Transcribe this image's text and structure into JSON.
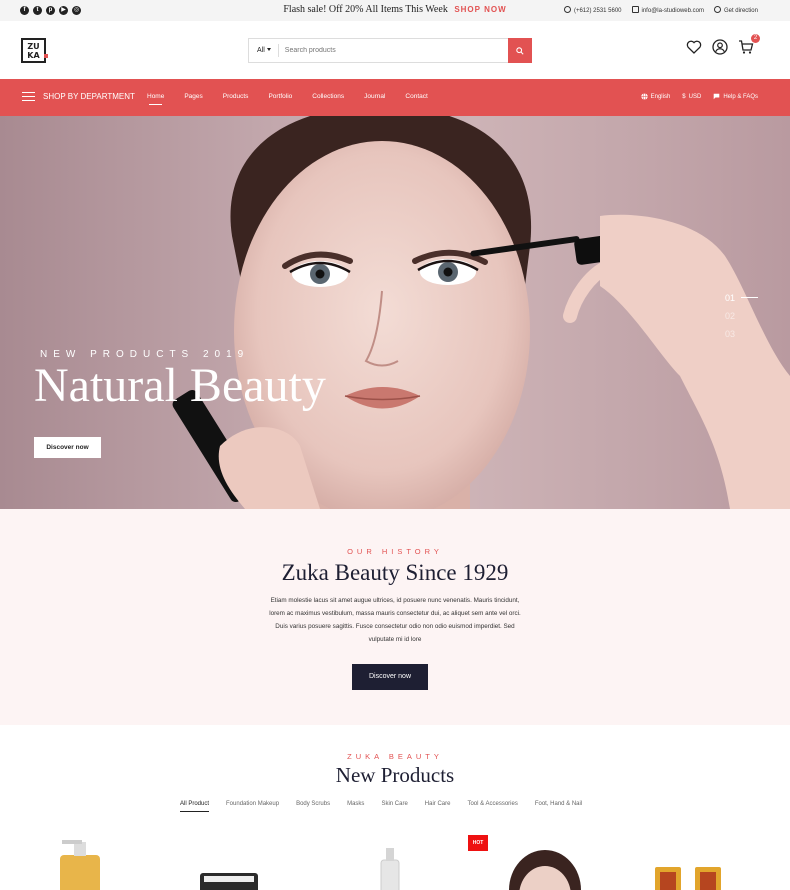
{
  "topbar": {
    "social_icons": [
      "facebook-icon",
      "twitter-icon",
      "pinterest-icon",
      "youtube-icon",
      "dribbble-icon"
    ],
    "flash_text": "Flash sale! Off 20% All Items This Week",
    "shop_now": "SHOP NOW",
    "phone": "(+612) 2531 5600",
    "email": "info@la-studioweb.com",
    "direction": "Get direction"
  },
  "header": {
    "logo_top": "ZU",
    "logo_bottom": "KA",
    "search_category": "All",
    "search_placeholder": "Search products",
    "cart_count": "2"
  },
  "nav": {
    "department": "SHOP BY DEPARTMENT",
    "items": [
      "Home",
      "Pages",
      "Products",
      "Portfolio",
      "Collections",
      "Journal",
      "Contact"
    ],
    "language": "English",
    "currency": "USD",
    "help": "Help & FAQs"
  },
  "hero": {
    "subtitle": "NEW PRODUCTS 2019",
    "title": "Natural Beauty",
    "button": "Discover now",
    "slides": [
      "01",
      "02",
      "03"
    ]
  },
  "history": {
    "tag": "OUR HISTORY",
    "title": "Zuka Beauty Since 1929",
    "body": "Etiam molestie lacus sit amet augue ultrices, id posuere nunc venenatis. Mauris tincidunt, lorem ac maximus vestibulum, massa mauris consectetur dui, ac aliquet sem ante vel orci. Duis varius posuere sagittis. Fusce consectetur odio non odio euismod imperdiet. Sed vulputate mi id lore",
    "button": "Discover now"
  },
  "products": {
    "tag": "ZUKA BEAUTY",
    "title": "New Products",
    "filters": [
      "All Product",
      "Foundation Makeup",
      "Body Scrubs",
      "Masks",
      "Skin Care",
      "Hair Care",
      "Tool & Accessories",
      "Foot, Hand & Nail"
    ],
    "hot_badge": "HOT"
  },
  "colors": {
    "accent": "#e25252",
    "dark": "#1e1f33",
    "history_bg": "#fdf4f4"
  }
}
